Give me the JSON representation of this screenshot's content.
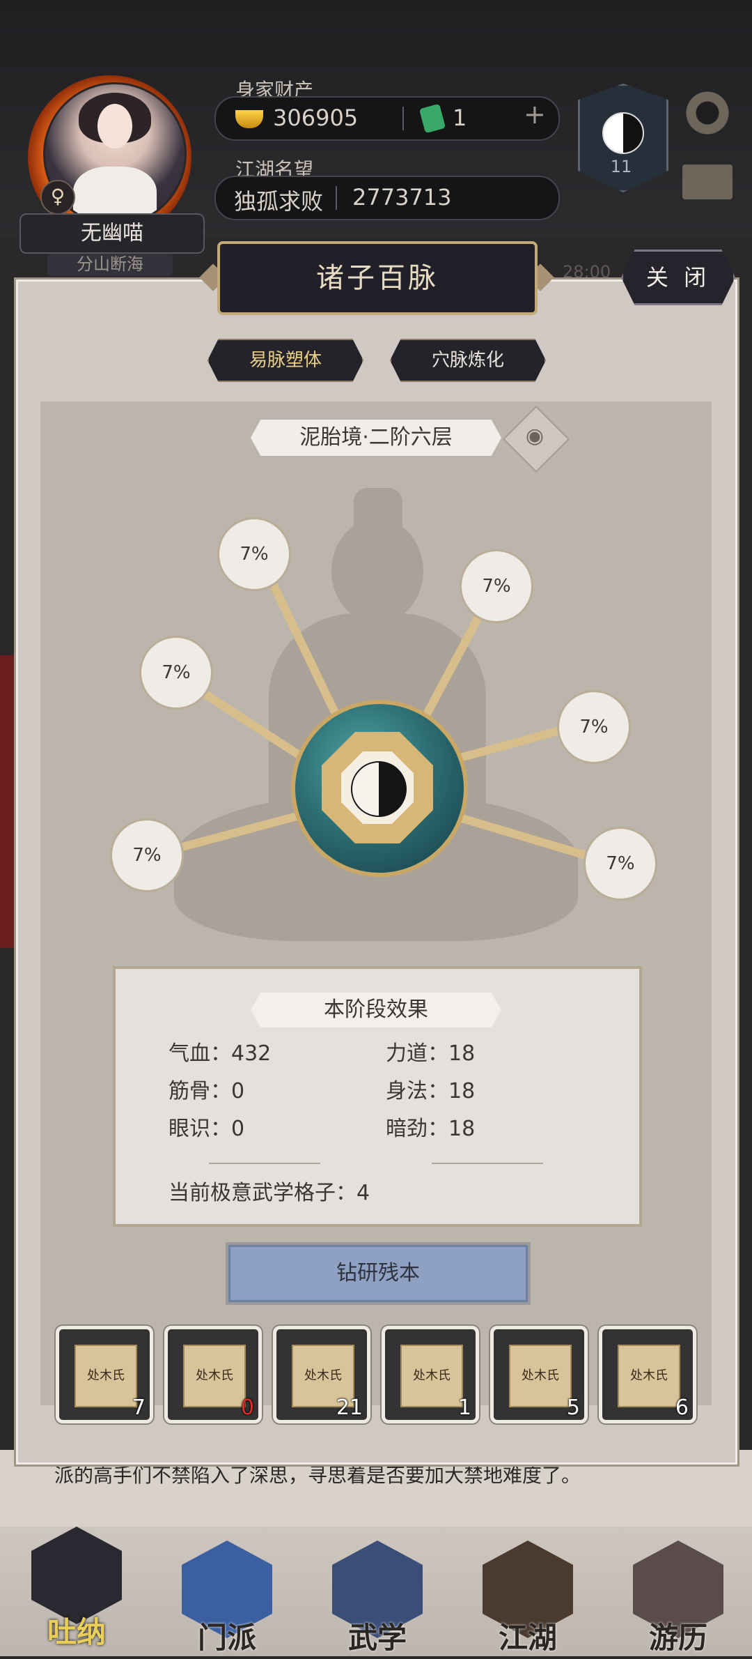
{
  "header": {
    "player_name": "无幽喵",
    "player_subtitle": "分山断海",
    "gender_symbol": "♀",
    "wealth_label": "身家财产",
    "gold_amount": "306905",
    "jade_amount": "1",
    "plus_symbol": "+",
    "reputation_label": "江湖名望",
    "reputation_title": "独孤求败",
    "reputation_value": "2773713",
    "rank_level": "11",
    "time_text": "28:00"
  },
  "panel": {
    "title": "诸子百脉",
    "close_label": "关 闭",
    "tabs": [
      {
        "label": "易脉塑体",
        "active": true
      },
      {
        "label": "穴脉炼化",
        "active": false
      }
    ],
    "stage_label": "泥胎境·二阶六层",
    "meridian_points": [
      "7%",
      "7%",
      "7%",
      "7%",
      "7%",
      "7%"
    ],
    "effects": {
      "title": "本阶段效果",
      "stats": [
        {
          "label": "气血：",
          "value": "432"
        },
        {
          "label": "力道：",
          "value": "18"
        },
        {
          "label": "筋骨：",
          "value": "0"
        },
        {
          "label": "身法：",
          "value": "18"
        },
        {
          "label": "眼识：",
          "value": "0"
        },
        {
          "label": "暗劲：",
          "value": "18"
        }
      ],
      "grid_label": "当前极意武学格子：",
      "grid_value": "4"
    },
    "study_button": "钻研残本",
    "items": [
      {
        "count": "7",
        "scroll_text": "处木氏"
      },
      {
        "count": "0",
        "scroll_text": "处木氏"
      },
      {
        "count": "21",
        "scroll_text": "处木氏"
      },
      {
        "count": "1",
        "scroll_text": "处木氏"
      },
      {
        "count": "5",
        "scroll_text": "处木氏"
      },
      {
        "count": "6",
        "scroll_text": "处木氏"
      }
    ]
  },
  "story_text": "派的高手们不禁陷入了深思，寻思着是否要加大禁地难度了。",
  "nav": [
    {
      "label": "吐纳",
      "active": true
    },
    {
      "label": "门派",
      "active": false
    },
    {
      "label": "武学",
      "active": false
    },
    {
      "label": "江湖",
      "active": false
    },
    {
      "label": "游历",
      "active": false
    }
  ],
  "colors": {
    "panel_bg": "#cfc8c3",
    "title_plate": "#211f28",
    "gold_trim": "#c2a97a",
    "study_button": "#8ea1c2",
    "active_tab_text": "#e8cf8a",
    "zero_count": "#e02a2a"
  }
}
